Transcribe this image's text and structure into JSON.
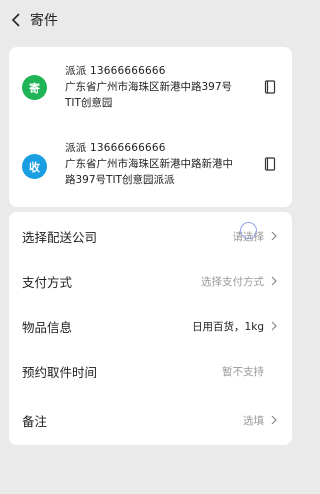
{
  "header": {
    "title": "寄件"
  },
  "sender": {
    "badge": "寄",
    "name_phone": "派派 13666666666",
    "address_lines": [
      "广东省广州市海珠区新港中路397号",
      "TIT创意园"
    ]
  },
  "receiver": {
    "badge": "收",
    "name_phone": "派派 13666666666",
    "address_lines": [
      "广东省广州市海珠区新港中路新港中",
      "路397号TIT创意园派派"
    ]
  },
  "options": [
    {
      "label": "选择配送公司",
      "value": "请选择"
    },
    {
      "label": "支付方式",
      "value": "选择支付方式"
    },
    {
      "label": "物品信息",
      "value": "日用百货，1kg"
    },
    {
      "label": "预约取件时间",
      "value": "暂不支持"
    },
    {
      "label": "备注",
      "value": "选填"
    }
  ],
  "colors": {
    "send_badge": "#1fb455",
    "recv_badge": "#1a9fe3",
    "background": "#eaeaea"
  },
  "icons": [
    "back-icon",
    "address-book-icon",
    "chevron-right-icon",
    "loading-icon"
  ]
}
